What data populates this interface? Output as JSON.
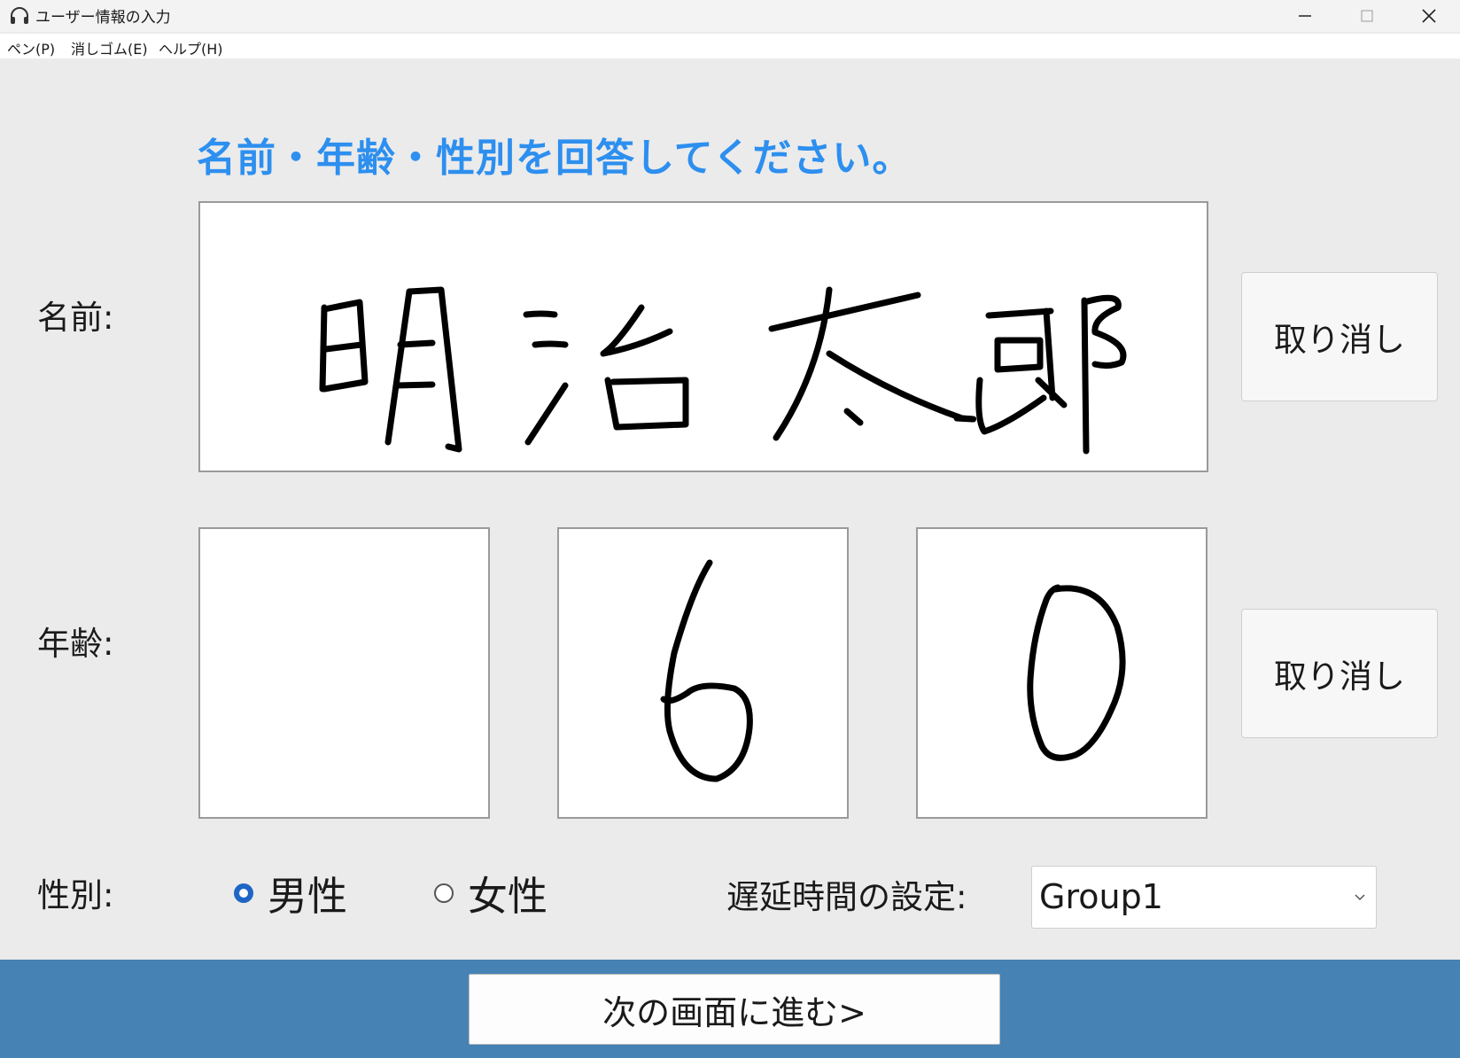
{
  "window": {
    "title": "ユーザー情報の入力",
    "icon": "headphones-icon"
  },
  "menubar": {
    "items": [
      {
        "label": "ペン(P)"
      },
      {
        "label": "消しゴム(E)"
      },
      {
        "label": "ヘルプ(H)"
      }
    ]
  },
  "form": {
    "heading": "名前・年齢・性別を回答してください。",
    "name": {
      "label": "名前:",
      "handwritten_text": "明治太郎",
      "undo_label": "取り消し"
    },
    "age": {
      "label": "年齢:",
      "digits": [
        "",
        "6",
        "0"
      ],
      "undo_label": "取り消し"
    },
    "gender": {
      "label": "性別:",
      "options": [
        {
          "label": "男性",
          "selected": true
        },
        {
          "label": "女性",
          "selected": false
        }
      ]
    },
    "delay": {
      "label": "遅延時間の設定:",
      "selected": "Group1"
    }
  },
  "footer": {
    "next_label": "次の画面に進む>"
  },
  "colors": {
    "heading": "#2d8fef",
    "footer": "#4682b4",
    "radio_selected": "#1e66c5"
  }
}
